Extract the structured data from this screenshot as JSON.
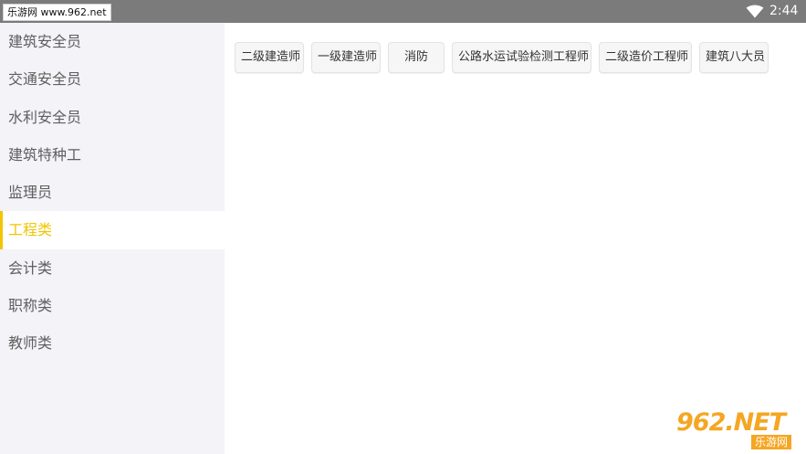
{
  "status_bar": {
    "watermark": "乐游网 www.962.net",
    "time": "2:44",
    "wifi_icon": "wifi-icon"
  },
  "sidebar": {
    "items": [
      {
        "label": "建筑安全员"
      },
      {
        "label": "交通安全员"
      },
      {
        "label": "水利安全员"
      },
      {
        "label": "建筑特种工"
      },
      {
        "label": "监理员"
      },
      {
        "label": "工程类",
        "active": true
      },
      {
        "label": "会计类"
      },
      {
        "label": "职称类"
      },
      {
        "label": "教师类"
      }
    ]
  },
  "main": {
    "chips": [
      {
        "label": "二级建造师"
      },
      {
        "label": "一级建造师"
      },
      {
        "label": "消防"
      },
      {
        "label": "公路水运试验检测工程师"
      },
      {
        "label": "二级造价工程师"
      },
      {
        "label": "建筑八大员"
      }
    ]
  },
  "watermark_br": {
    "logo": "962.NET",
    "text": "乐游网"
  },
  "colors": {
    "accent": "#f2c500",
    "status_bar": "#7b7b7b",
    "sidebar_bg": "#f3f3f8"
  }
}
